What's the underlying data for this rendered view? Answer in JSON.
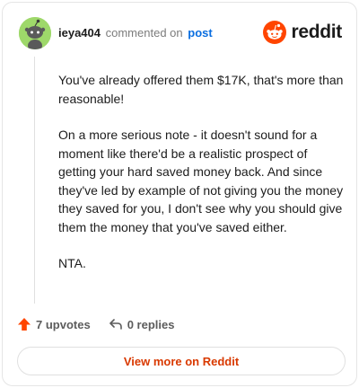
{
  "header": {
    "username": "ieya404",
    "action_text": "commented on",
    "target_link": "post"
  },
  "brand": {
    "wordmark": "reddit",
    "icon": "reddit-snoo-logo",
    "color": "#FF4500"
  },
  "comment": {
    "paragraphs": [
      "You've already offered them $17K, that's more than reasonable!",
      "On a more serious note - it doesn't sound for a moment like there'd be a realistic prospect of getting your hard saved money back. And since they've led by example of not giving you the money they saved for you, I don't see why you should give them the money that you've saved either.",
      "NTA."
    ]
  },
  "actions": {
    "upvotes_label": "7 upvotes",
    "upvote_icon": "upvote-arrow-icon",
    "upvote_color": "#FF4500",
    "replies_label": "0 replies",
    "reply_icon": "reply-arrow-icon"
  },
  "footer": {
    "view_more_label": "View more on Reddit",
    "accent": "#D93900"
  },
  "avatar": {
    "background": "#9ED86A",
    "icon": "snoo-avatar"
  }
}
